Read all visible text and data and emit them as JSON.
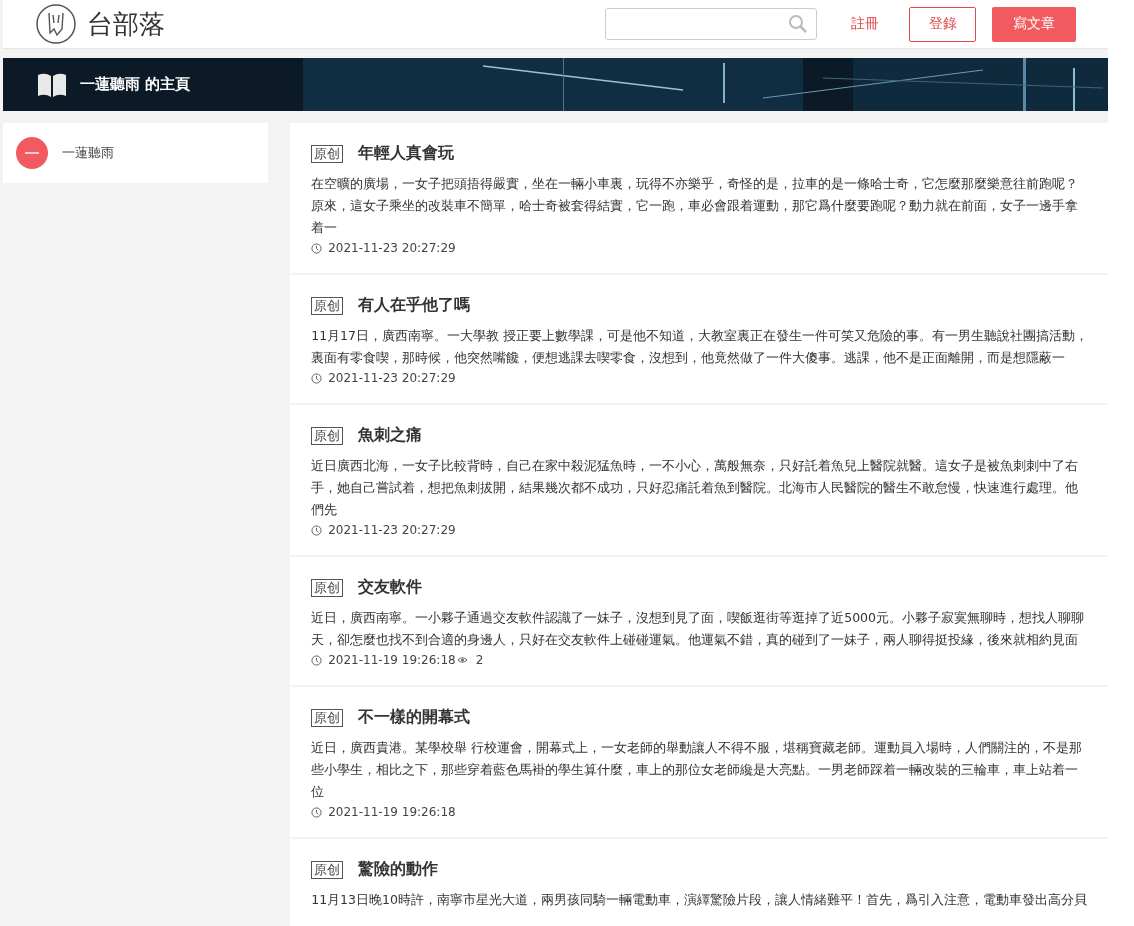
{
  "header": {
    "site_name": "台部落",
    "register_link": "註冊",
    "login_button": "登錄",
    "write_button": "寫文章"
  },
  "banner": {
    "title": "一蓮聽雨 的主頁"
  },
  "sidebar": {
    "user_name": "一蓮聽雨"
  },
  "articles": [
    {
      "tag": "原创",
      "title": "年輕人真會玩",
      "excerpt_lines": [
        "在空曠的廣場，一女子把頭捂得嚴實，坐在一輛小車裏，玩得不亦樂乎，奇怪的是，拉車的是一條哈士奇，它怎麼那麼樂意往前跑呢？",
        "原來，這女子乘坐的改裝車不簡單，哈士奇被套得結實，它一跑，車必會跟着運動，那它爲什麼要跑呢？動力就在前面，女子一邊手拿",
        "着一"
      ],
      "date": "2021-11-23 20:27:29"
    },
    {
      "tag": "原创",
      "title": "有人在乎他了嗎",
      "excerpt_lines": [
        "11月17日，廣西南寧。一大學教 授正要上數學課，可是他不知道，大教室裏正在發生一件可笑又危險的事。有一男生聽說社團搞活動，",
        "裏面有零食喫，那時候，他突然嘴饞，便想逃課去喫零食，沒想到，他竟然做了一件大傻事。逃課，他不是正面離開，而是想隱蔽一"
      ],
      "date": "2021-11-23 20:27:29"
    },
    {
      "tag": "原创",
      "title": "魚刺之痛",
      "excerpt_lines": [
        "近日廣西北海，一女子比較背時，自己在家中殺泥猛魚時，一不小心，萬般無奈，只好託着魚兒上醫院就醫。這女子是被魚刺刺中了右",
        "手，她自己嘗試着，想把魚刺拔開，結果幾次都不成功，只好忍痛託着魚到醫院。北海市人民醫院的醫生不敢怠慢，快速進行處理。他",
        "們先"
      ],
      "date": "2021-11-23 20:27:29"
    },
    {
      "tag": "原创",
      "title": "交友軟件",
      "excerpt_lines": [
        "近日，廣西南寧。一小夥子通過交友軟件認識了一妹子，沒想到見了面，喫飯逛街等逛掉了近5000元。小夥子寂寞無聊時，想找人聊聊",
        "天，卻怎麼也找不到合適的身邊人，只好在交友軟件上碰碰運氣。他運氣不錯，真的碰到了一妹子，兩人聊得挺投緣，後來就相約見面"
      ],
      "date": "2021-11-19 19:26:18",
      "views": "2"
    },
    {
      "tag": "原创",
      "title": "不一樣的開幕式",
      "excerpt_lines": [
        "近日，廣西貴港。某學校舉 行校運會，開幕式上，一女老師的舉動讓人不得不服，堪稱寶藏老師。運動員入場時，人們關注的，不是那",
        "些小學生，相比之下，那些穿着藍色馬褂的學生算什麼，車上的那位女老師纔是大亮點。一男老師踩着一輛改裝的三輪車，車上站着一",
        "位"
      ],
      "date": "2021-11-19 19:26:18"
    },
    {
      "tag": "原创",
      "title": "驚險的動作",
      "excerpt_lines": [
        "11月13日晚10時許，南寧市星光大道，兩男孩同騎一輛電動車，演繹驚險片段，讓人情緒難平！首先，爲引入注意，電動車發出高分貝"
      ]
    }
  ]
}
